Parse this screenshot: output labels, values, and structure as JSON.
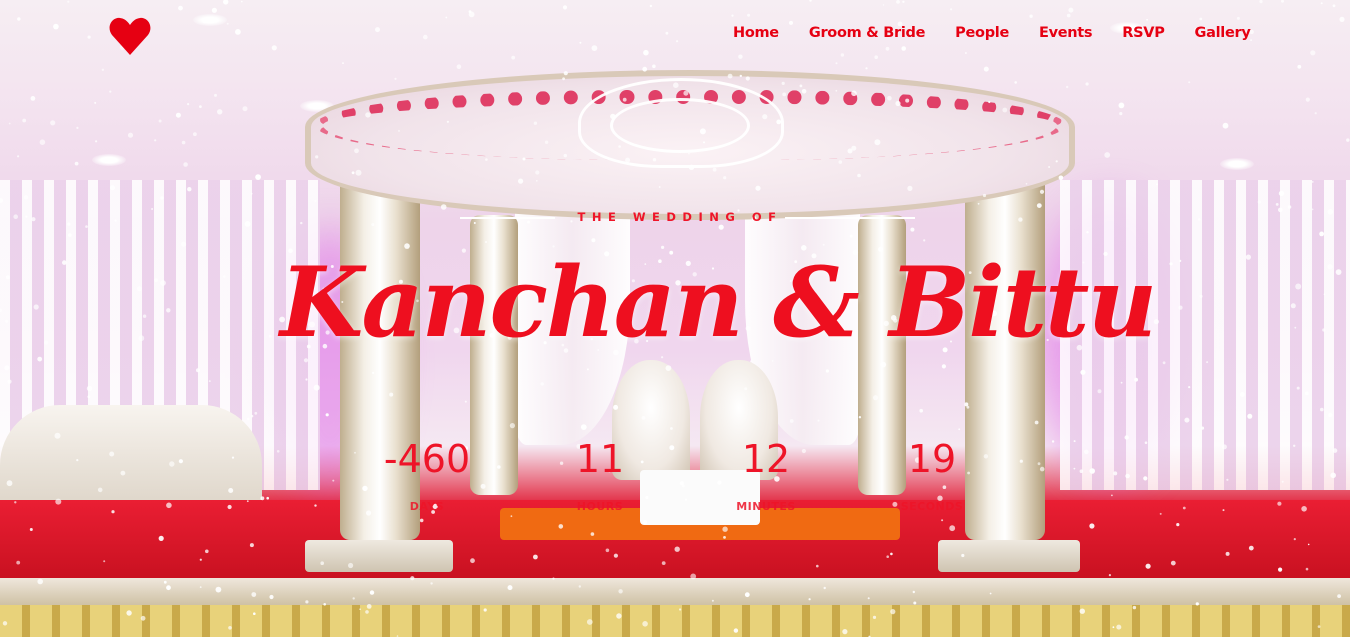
{
  "nav": {
    "logo": "heart-icon",
    "items": [
      {
        "label": "Home"
      },
      {
        "label": "Groom & Bride"
      },
      {
        "label": "People"
      },
      {
        "label": "Events"
      },
      {
        "label": "RSVP"
      },
      {
        "label": "Gallery"
      }
    ]
  },
  "hero": {
    "eyebrow": "THE WEDDING OF",
    "names": "Kanchan & Bittu"
  },
  "countdown": [
    {
      "value": "-460",
      "label": "DAYS"
    },
    {
      "value": "11",
      "label": "HOURS"
    },
    {
      "value": "12",
      "label": "MINUTES"
    },
    {
      "value": "19",
      "label": "SECONDS"
    }
  ],
  "colors": {
    "accent": "#e60012"
  }
}
